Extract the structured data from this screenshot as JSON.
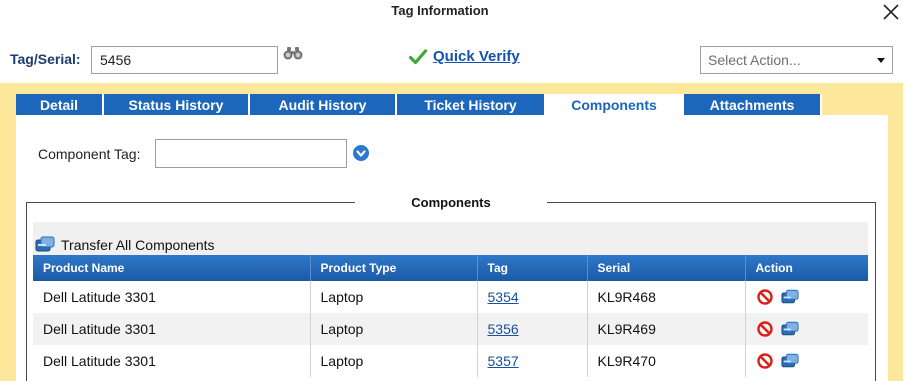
{
  "window": {
    "title": "Tag Information"
  },
  "header": {
    "tag_serial_label": "Tag/Serial:",
    "tag_serial_value": "5456",
    "quick_verify_label": "Quick Verify",
    "action_select_placeholder": "Select Action..."
  },
  "tabs": [
    {
      "label": "Detail",
      "active": false
    },
    {
      "label": "Status History",
      "active": false
    },
    {
      "label": "Audit History",
      "active": false
    },
    {
      "label": "Ticket History",
      "active": false
    },
    {
      "label": "Components",
      "active": true
    },
    {
      "label": "Attachments",
      "active": false
    }
  ],
  "components": {
    "component_tag_label": "Component Tag:",
    "component_tag_value": "",
    "section_title": "Components",
    "transfer_all_label": "Transfer All Components",
    "columns": [
      "Product Name",
      "Product Type",
      "Tag",
      "Serial",
      "Action"
    ],
    "rows": [
      {
        "product_name": "Dell Latitude 3301",
        "product_type": "Laptop",
        "tag": "5354",
        "serial": "KL9R468"
      },
      {
        "product_name": "Dell Latitude 3301",
        "product_type": "Laptop",
        "tag": "5356",
        "serial": "KL9R469"
      },
      {
        "product_name": "Dell Latitude 3301",
        "product_type": "Laptop",
        "tag": "5357",
        "serial": "KL9R470"
      }
    ]
  },
  "icons": {
    "close": "close-icon",
    "find": "binoculars-icon",
    "quick_verify": "checkmark-icon",
    "dropdown": "chevron-down-icon",
    "add_component": "arrow-down-circle-icon",
    "transfer": "transfer-icon",
    "remove": "remove-icon"
  },
  "colors": {
    "accent_blue": "#1c66bb",
    "link_blue": "#1454a8",
    "frame_yellow": "#fde79a",
    "check_green": "#3aaa35",
    "remove_red": "#d9201a"
  }
}
